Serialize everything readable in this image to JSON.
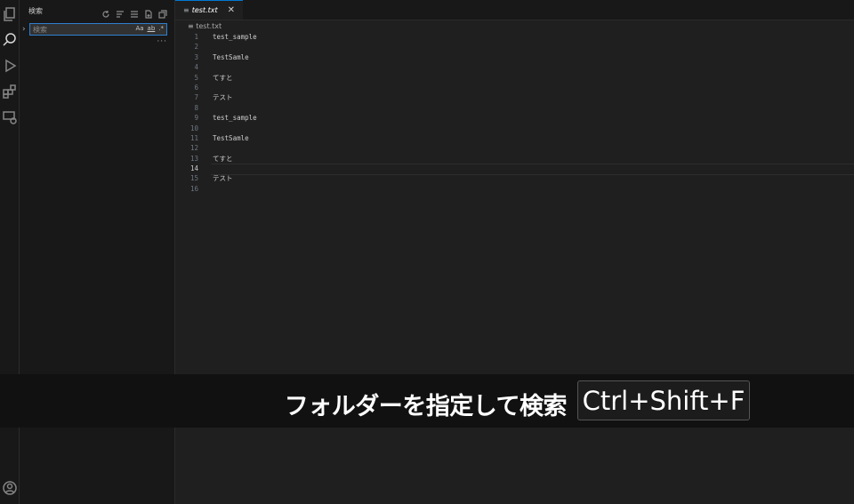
{
  "sidebar": {
    "title": "検索",
    "search": {
      "placeholder": "検索",
      "value": ""
    },
    "options": {
      "match_case": "Aa",
      "whole_word": "ab",
      "regex": ".*"
    },
    "more": "···"
  },
  "editor": {
    "tab": {
      "name": "test.txt",
      "close": "✕"
    },
    "breadcrumb": "test.txt",
    "current_line": 14,
    "lines": [
      {
        "num": "1",
        "text": "test_sample"
      },
      {
        "num": "2",
        "text": ""
      },
      {
        "num": "3",
        "text": "TestSamle"
      },
      {
        "num": "4",
        "text": ""
      },
      {
        "num": "5",
        "text": "てすと"
      },
      {
        "num": "6",
        "text": ""
      },
      {
        "num": "7",
        "text": "テスト"
      },
      {
        "num": "8",
        "text": ""
      },
      {
        "num": "9",
        "text": "test_sample"
      },
      {
        "num": "10",
        "text": ""
      },
      {
        "num": "11",
        "text": "TestSamle"
      },
      {
        "num": "12",
        "text": ""
      },
      {
        "num": "13",
        "text": "てすと"
      },
      {
        "num": "14",
        "text": ""
      },
      {
        "num": "15",
        "text": "テスト"
      },
      {
        "num": "16",
        "text": ""
      }
    ]
  },
  "overlay": {
    "caption": "フォルダーを指定して検索",
    "shortcut": "Ctrl+Shift+F"
  },
  "colors": {
    "accent": "#0078d4",
    "focus_border": "#2f7fd0",
    "background": "#1f1f1f",
    "sidebar": "#181818"
  }
}
